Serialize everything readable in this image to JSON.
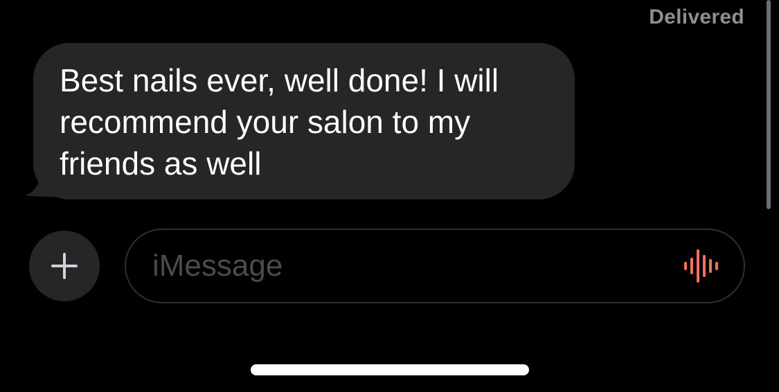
{
  "conversation": {
    "delivery_status": "Delivered",
    "messages": [
      {
        "direction": "incoming",
        "text": "Best nails ever, well done! I will recommend your salon to my friends as well"
      }
    ]
  },
  "composer": {
    "plus_icon": "plus-icon",
    "placeholder": "iMessage",
    "audio_icon": "audio-waveform-icon",
    "audio_icon_color": "#f2715a"
  },
  "colors": {
    "background": "#000000",
    "incoming_bubble": "#262629",
    "status_text": "#8e8e93",
    "placeholder_text": "#4a4a4f"
  }
}
